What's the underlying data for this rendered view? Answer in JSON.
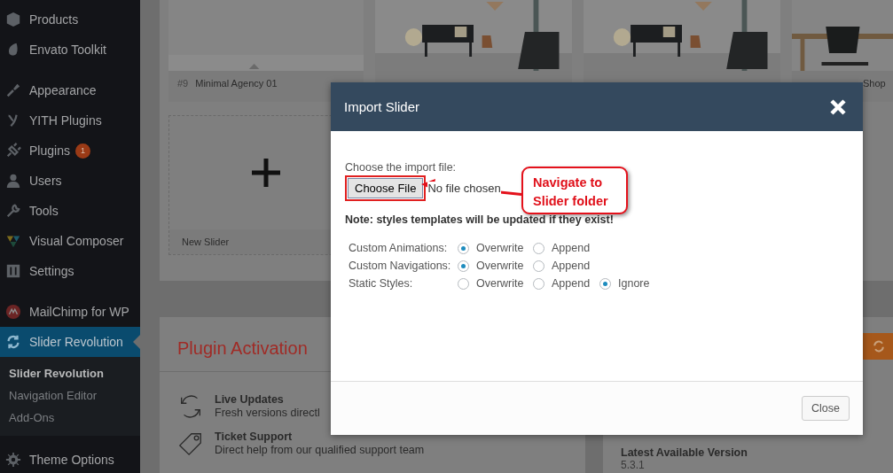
{
  "sidebar": {
    "groups": [
      [
        {
          "label": "Products",
          "selected": false
        },
        {
          "label": "Envato Toolkit",
          "selected": false
        }
      ],
      [
        {
          "label": "Appearance",
          "selected": false
        },
        {
          "label": "YITH Plugins",
          "selected": false
        },
        {
          "label": "Plugins",
          "selected": false,
          "badge": "1"
        },
        {
          "label": "Users",
          "selected": false
        },
        {
          "label": "Tools",
          "selected": false
        },
        {
          "label": "Visual Composer",
          "selected": false
        },
        {
          "label": "Settings",
          "selected": false
        }
      ],
      [
        {
          "label": "MailChimp for WP",
          "selected": false
        },
        {
          "label": "Slider Revolution",
          "selected": true,
          "children": [
            {
              "label": "Slider Revolution",
              "selected": true
            },
            {
              "label": "Navigation Editor",
              "selected": false
            },
            {
              "label": "Add-Ons",
              "selected": false
            }
          ]
        }
      ],
      [
        {
          "label": "Theme Options",
          "selected": false
        }
      ]
    ]
  },
  "sliders": {
    "cards": [
      {
        "kind": "picture",
        "number": "#9",
        "title": "Minimal Agency 01"
      },
      {
        "kind": "picture"
      },
      {
        "kind": "picture"
      },
      {
        "kind": "picture",
        "title": "Shop"
      }
    ],
    "new_slider": {
      "label": "New Slider"
    }
  },
  "plugin_activation": {
    "title": "Plugin Activation",
    "features": [
      {
        "title": "Live Updates",
        "description": "Fresh versions directl"
      },
      {
        "title": "Ticket Support",
        "description": "Direct help from our qualified support team"
      }
    ]
  },
  "version_panel": {
    "heading": "Latest Available Version",
    "value": "5.3.1"
  },
  "modal": {
    "title": "Import Slider",
    "file_label": "Choose the import file:",
    "file_button": "Choose File",
    "file_status": "No file chosen",
    "note": "Note: styles templates will be updated if they exist!",
    "options": [
      {
        "label": "Custom Animations:",
        "choices": [
          {
            "label": "Overwrite",
            "selected": true
          },
          {
            "label": "Append",
            "selected": false
          }
        ]
      },
      {
        "label": "Custom Navigations:",
        "choices": [
          {
            "label": "Overwrite",
            "selected": true
          },
          {
            "label": "Append",
            "selected": false
          }
        ]
      },
      {
        "label": "Static Styles:",
        "choices": [
          {
            "label": "Overwrite",
            "selected": false
          },
          {
            "label": "Append",
            "selected": false
          },
          {
            "label": "Ignore",
            "selected": true
          }
        ]
      }
    ],
    "close_button": "Close"
  },
  "annotation": {
    "text": "Navigate to Slider folder"
  }
}
